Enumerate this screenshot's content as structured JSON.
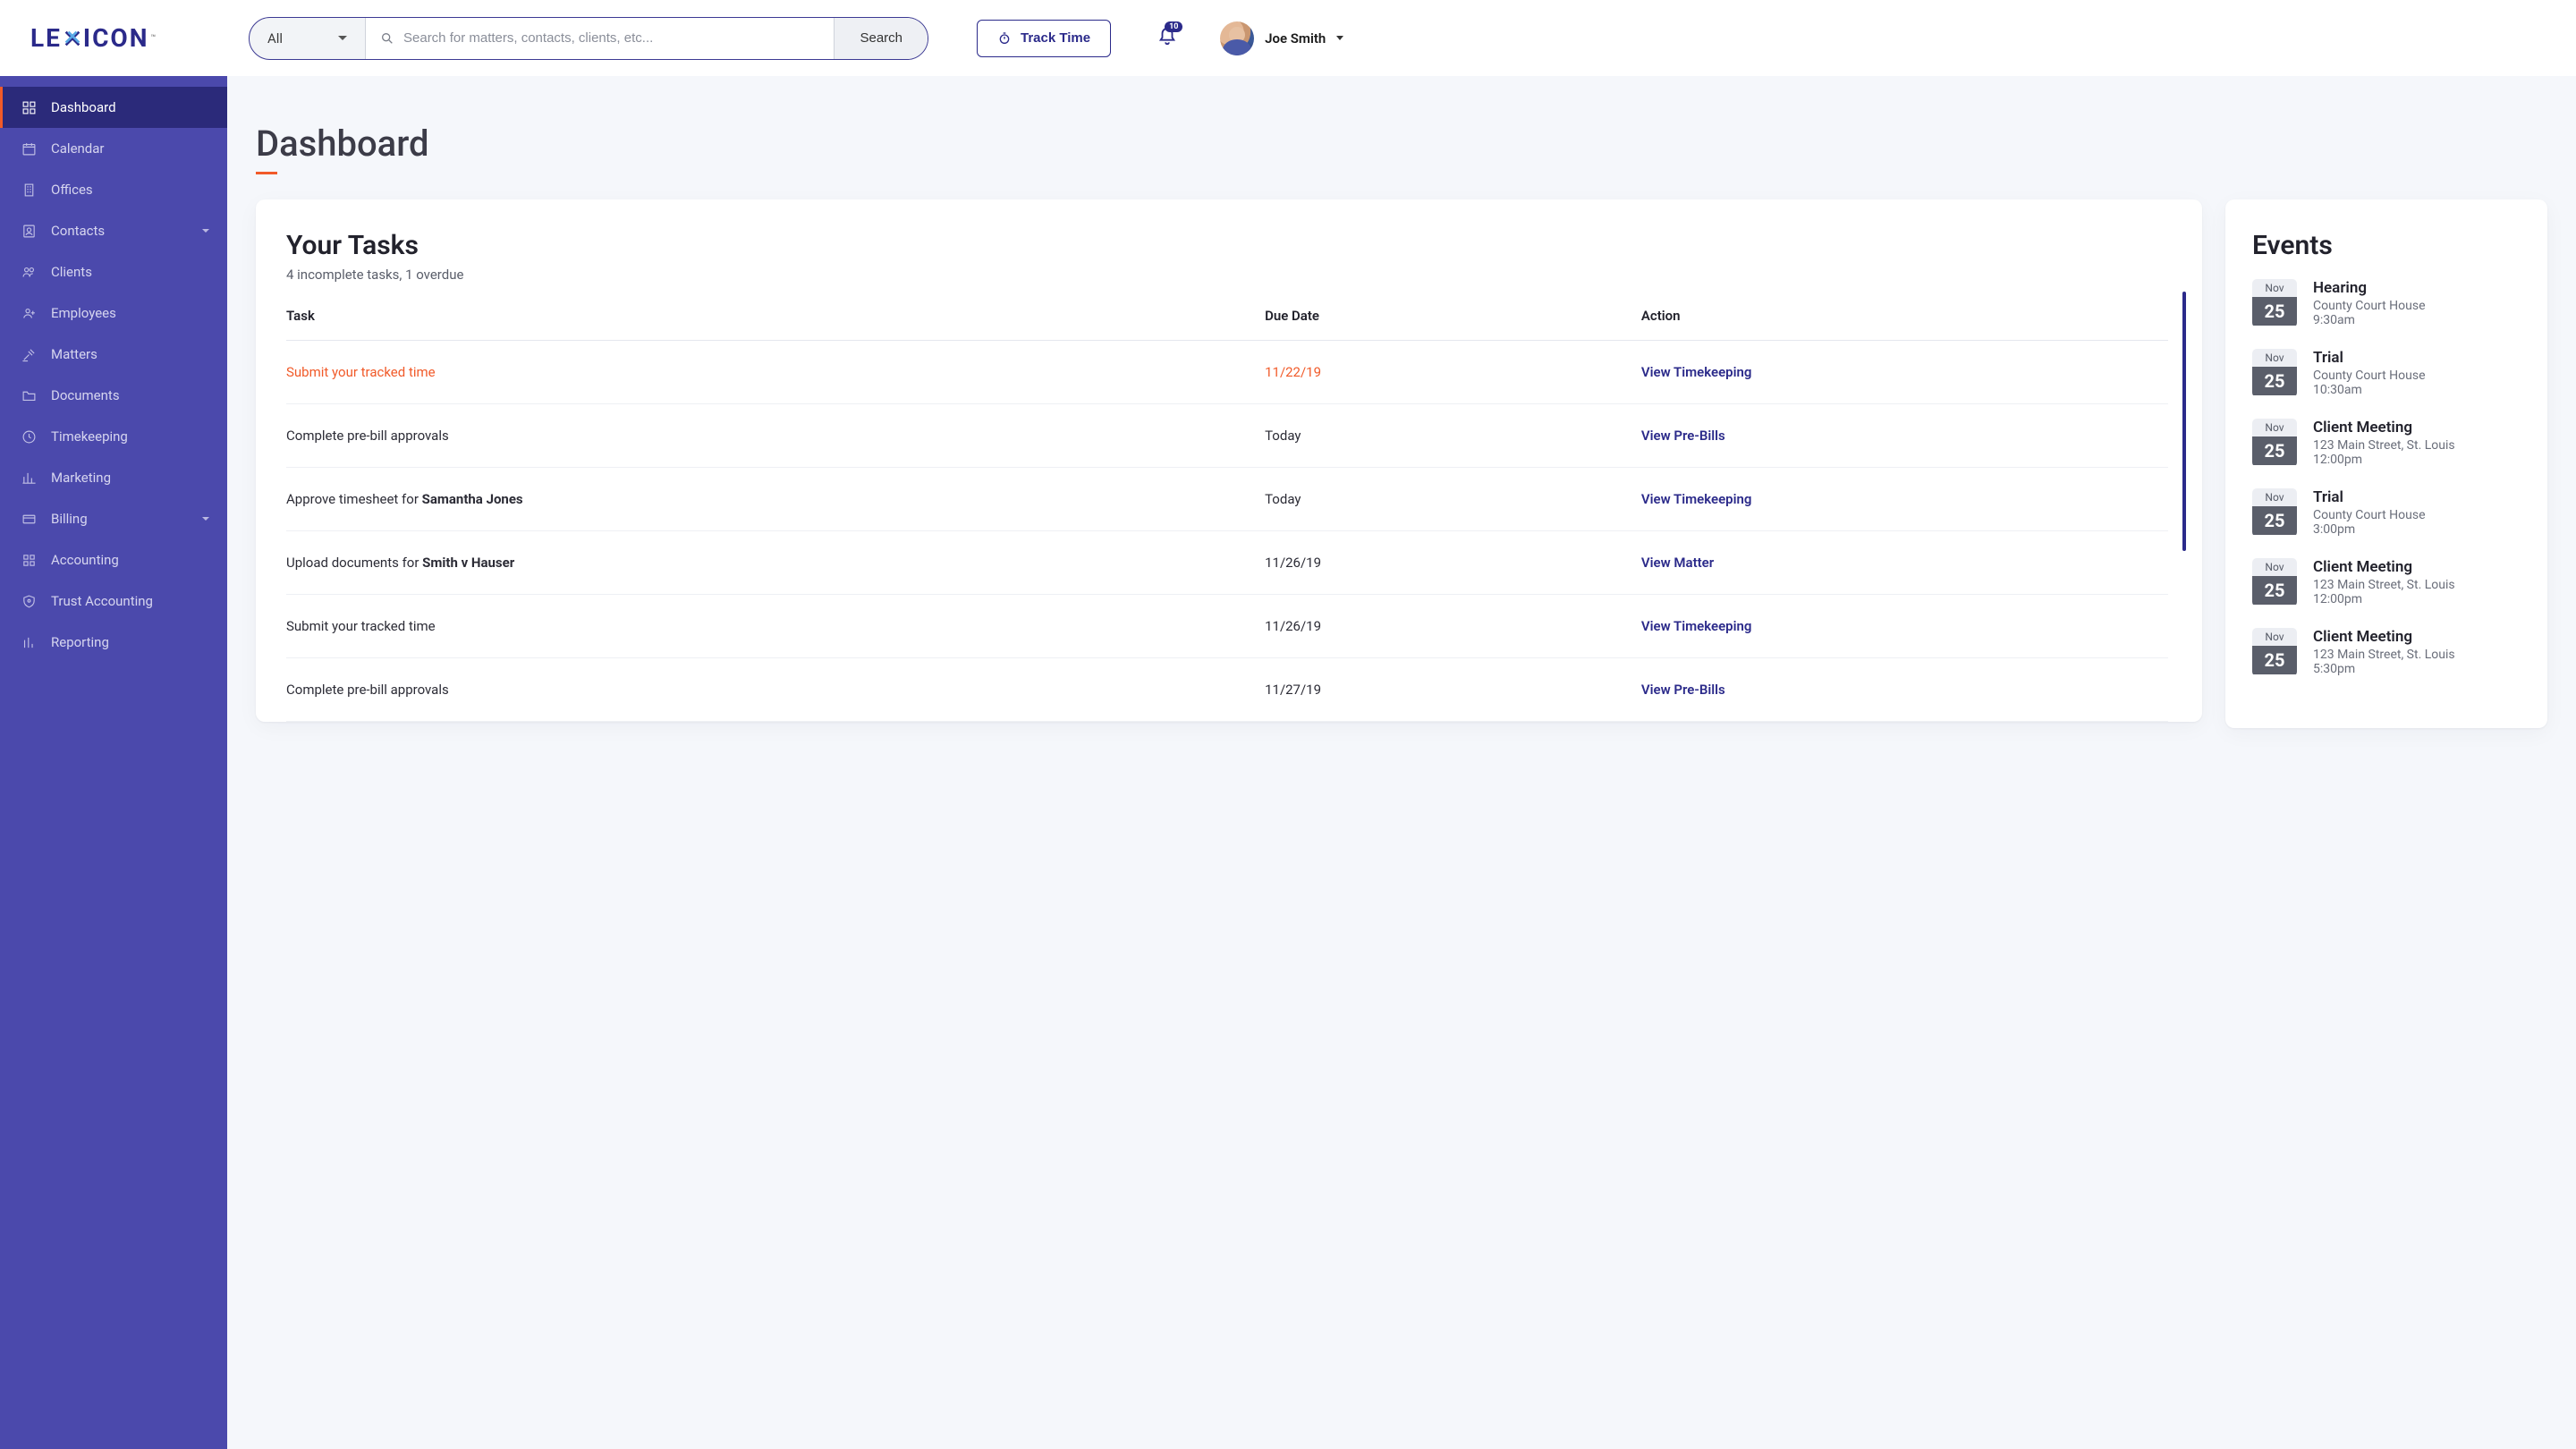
{
  "brand": "LEXICON",
  "search": {
    "filter": "All",
    "placeholder": "Search for matters, contacts, clients, etc...",
    "button": "Search"
  },
  "track_time_label": "Track Time",
  "notification_count": "10",
  "user": {
    "name": "Joe Smith"
  },
  "sidebar": [
    {
      "label": "Dashboard",
      "icon": "grid",
      "active": true
    },
    {
      "label": "Calendar",
      "icon": "calendar"
    },
    {
      "label": "Offices",
      "icon": "building"
    },
    {
      "label": "Contacts",
      "icon": "contacts",
      "expandable": true
    },
    {
      "label": "Clients",
      "icon": "people"
    },
    {
      "label": "Employees",
      "icon": "person-plus"
    },
    {
      "label": "Matters",
      "icon": "gavel"
    },
    {
      "label": "Documents",
      "icon": "folder"
    },
    {
      "label": "Timekeeping",
      "icon": "clock"
    },
    {
      "label": "Marketing",
      "icon": "chart"
    },
    {
      "label": "Billing",
      "icon": "card",
      "expandable": true
    },
    {
      "label": "Accounting",
      "icon": "tiles"
    },
    {
      "label": "Trust Accounting",
      "icon": "shield"
    },
    {
      "label": "Reporting",
      "icon": "bars"
    }
  ],
  "page_title": "Dashboard",
  "tasks": {
    "title": "Your Tasks",
    "subtitle": "4 incomplete tasks, 1 overdue",
    "columns": {
      "task": "Task",
      "due": "Due Date",
      "action": "Action"
    },
    "rows": [
      {
        "name": "Submit your tracked time",
        "due": "11/22/19",
        "action": "View Timekeeping",
        "overdue": true
      },
      {
        "name": "Complete pre-bill approvals",
        "due": "Today",
        "action": "View Pre-Bills"
      },
      {
        "name_prefix": "Approve timesheet for ",
        "name_bold": "Samantha Jones",
        "due": "Today",
        "action": "View Timekeeping"
      },
      {
        "name_prefix": "Upload documents for ",
        "name_bold": "Smith v Hauser",
        "due": "11/26/19",
        "action": "View Matter"
      },
      {
        "name": "Submit your tracked time",
        "due": "11/26/19",
        "action": "View Timekeeping"
      },
      {
        "name": "Complete pre-bill approvals",
        "due": "11/27/19",
        "action": "View Pre-Bills"
      }
    ]
  },
  "events": {
    "title": "Events",
    "items": [
      {
        "month": "Nov",
        "day": "25",
        "title": "Hearing",
        "location": "County Court House",
        "time": "9:30am"
      },
      {
        "month": "Nov",
        "day": "25",
        "title": "Trial",
        "location": "County Court House",
        "time": "10:30am"
      },
      {
        "month": "Nov",
        "day": "25",
        "title": "Client Meeting",
        "location": "123 Main Street, St. Louis",
        "time": "12:00pm"
      },
      {
        "month": "Nov",
        "day": "25",
        "title": "Trial",
        "location": "County Court House",
        "time": "3:00pm"
      },
      {
        "month": "Nov",
        "day": "25",
        "title": "Client Meeting",
        "location": "123 Main Street, St. Louis",
        "time": "12:00pm"
      },
      {
        "month": "Nov",
        "day": "25",
        "title": "Client Meeting",
        "location": "123 Main Street, St. Louis",
        "time": "5:30pm"
      }
    ]
  }
}
